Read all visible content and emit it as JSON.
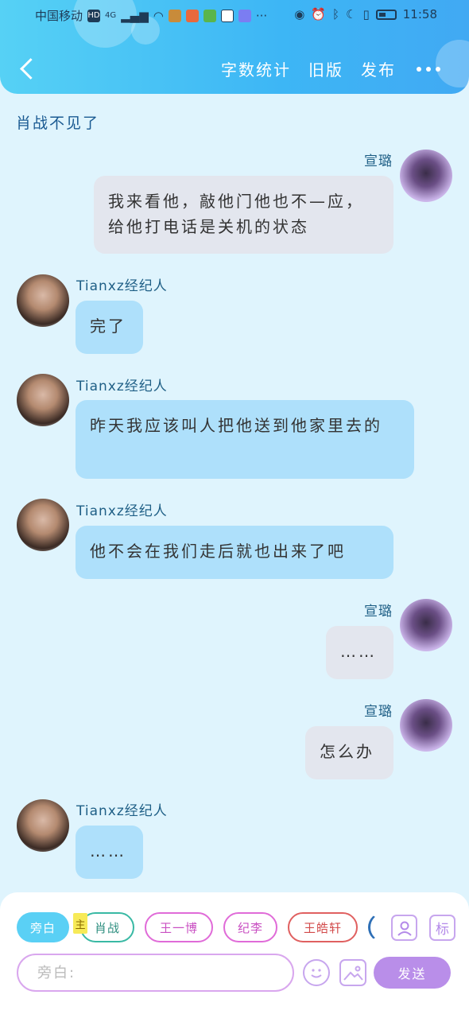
{
  "status_bar": {
    "carrier": "中国移动",
    "network_badges": [
      "HD",
      "4G"
    ],
    "time": "11:58",
    "more": "···"
  },
  "navbar": {
    "word_count": "字数统计",
    "old_version": "旧版",
    "publish": "发布"
  },
  "top_note": "肖战不见了",
  "messages": [
    {
      "speaker": "宣璐",
      "side": "right",
      "text": "我来看他，敲他门他也不—应，给他打电话是关机的状态"
    },
    {
      "speaker": "Tianxz经纪人",
      "side": "left",
      "text": "完了"
    },
    {
      "speaker": "Tianxz经纪人",
      "side": "left",
      "text": "昨天我应该叫人把他送到他家里去的"
    },
    {
      "speaker": "Tianxz经纪人",
      "side": "left",
      "text": "他不会在我们走后就也出来了吧"
    },
    {
      "speaker": "宣璐",
      "side": "right",
      "text": "……"
    },
    {
      "speaker": "宣璐",
      "side": "right",
      "text": "怎么办"
    },
    {
      "speaker": "Tianxz经纪人",
      "side": "left",
      "text": "……"
    }
  ],
  "composer": {
    "roles": [
      "旁白",
      "肖战",
      "王一博",
      "纪李",
      "王皓轩"
    ],
    "main_badge": "主",
    "tag_icon_label": "标",
    "input_placeholder": "旁白:",
    "send_label": "发送"
  }
}
